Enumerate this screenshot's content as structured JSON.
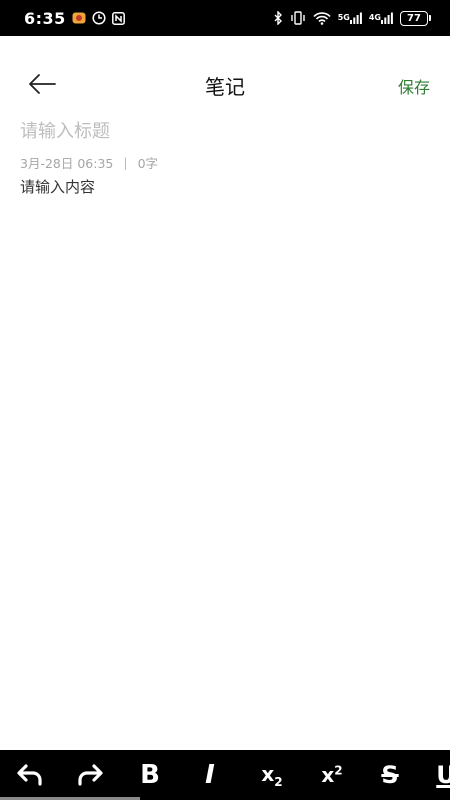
{
  "status_bar": {
    "time": "6:35",
    "battery": "77",
    "network_1": "5G",
    "network_2": "4G"
  },
  "header": {
    "title": "笔记",
    "save_label": "保存"
  },
  "editor": {
    "title_placeholder": "请输入标题",
    "date": "3月-28日 06:35",
    "separator": "|",
    "word_count": "0字",
    "content_placeholder": "请输入内容"
  },
  "toolbar": {
    "bold_label": "B",
    "italic_label": "I",
    "subscript_base": "x",
    "subscript_index": "2",
    "superscript_base": "x",
    "superscript_index": "2",
    "strike_label": "S",
    "underline_label": "U"
  },
  "colors": {
    "accent": "#2e7d32",
    "toolbar_bg": "#000000",
    "placeholder": "#bdbdbd"
  }
}
